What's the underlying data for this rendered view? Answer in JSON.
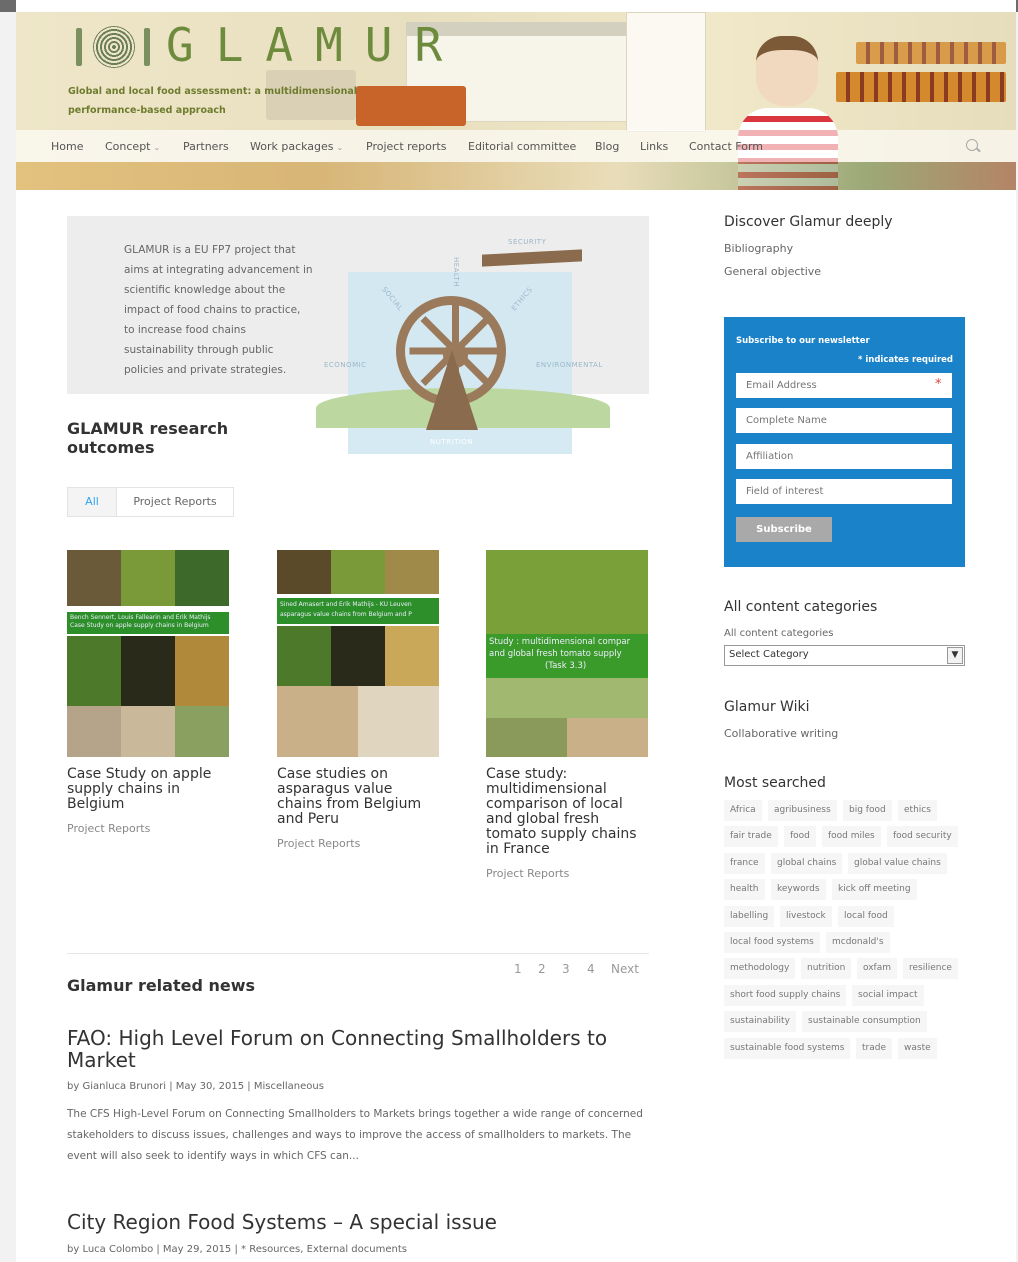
{
  "site": {
    "logo_text": "GLAMUR",
    "tagline_line1": "Global and local food assessment: a multidimensional",
    "tagline_line2": "performance-based approach"
  },
  "nav": {
    "items": [
      {
        "label": "Home",
        "dropdown": false
      },
      {
        "label": "Concept",
        "dropdown": true
      },
      {
        "label": "Partners",
        "dropdown": false
      },
      {
        "label": "Work packages",
        "dropdown": true
      },
      {
        "label": "Project reports",
        "dropdown": false
      },
      {
        "label": "Editorial committee",
        "dropdown": false
      },
      {
        "label": "Blog",
        "dropdown": false
      },
      {
        "label": "Links",
        "dropdown": false
      },
      {
        "label": "Contact Form",
        "dropdown": false
      }
    ],
    "dropdown_glyph": "⌄"
  },
  "intro": {
    "text": "GLAMUR is a EU FP7 project that aims at integrating advancement in scientific knowledge about the impact of food chains to practice, to increase food chains sustainability through public policies and private strategies.",
    "diagram_labels": {
      "security": "SECURITY",
      "economic": "ECONOMIC",
      "environmental": "ENVIRONMENTAL",
      "nutrition": "NUTRITION",
      "social": "SOCIAL",
      "health": "HEALTH",
      "ethics": "ETHICS"
    }
  },
  "outcomes": {
    "heading": "GLAMUR research outcomes",
    "filters": [
      "All",
      "Project Reports"
    ],
    "active_filter": "All",
    "cards": [
      {
        "title": "Case Study on apple supply chains in Belgium",
        "category": "Project Reports",
        "band_text_1": "Bench Sennert, Louis Fallearin and Erik Mathijs",
        "band_text_2": "Case Study on apple supply chains in Belgium"
      },
      {
        "title": "Case studies on asparagus value chains from Belgium and Peru",
        "category": "Project Reports",
        "band_text_1": "Sined Amasert and Erik Mathijs - KU Leuven",
        "band_text_2": "asparagus value chains from Belgium and P"
      },
      {
        "title": "Case study: multidimensional comparison of local and global fresh tomato supply chains in France",
        "category": "Project Reports",
        "band_text_1": "Study : multidimensional compar",
        "band_text_2": "and global fresh tomato supply",
        "band_text_3": "(Task 3.3)"
      }
    ]
  },
  "pagination": {
    "pages": [
      "1",
      "2",
      "3",
      "4"
    ],
    "next": "Next"
  },
  "news": {
    "heading": "Glamur related news",
    "posts": [
      {
        "title": "FAO: High Level Forum on Connecting Smallholders to Market",
        "meta": "by Gianluca Brunori | May 30, 2015 | Miscellaneous",
        "excerpt": "The CFS High-Level Forum on Connecting Smallholders to Markets brings together a wide range of concerned stakeholders to discuss issues, challenges and ways to improve the access of smallholders to markets. The event will also seek to identify ways in which CFS can..."
      },
      {
        "title": "City Region Food Systems – A special issue",
        "meta": "by Luca Colombo | May 29, 2015 | * Resources, External documents"
      }
    ]
  },
  "sidebar": {
    "discover": {
      "title": "Discover Glamur deeply",
      "links": [
        "Bibliography",
        "General objective"
      ]
    },
    "newsletter": {
      "title": "Subscribe to our newsletter",
      "required_note": "* indicates required",
      "fields": [
        {
          "placeholder": "Email Address",
          "required": true
        },
        {
          "placeholder": "Complete Name",
          "required": false
        },
        {
          "placeholder": "Affiliation",
          "required": false
        },
        {
          "placeholder": "Field of interest",
          "required": false
        }
      ],
      "button": "Subscribe",
      "color": "#1a82c9"
    },
    "categories": {
      "title": "All content categories",
      "label": "All content categories",
      "selected": "Select Category"
    },
    "wiki": {
      "title": "Glamur Wiki",
      "link": "Collaborative writing"
    },
    "most_searched": {
      "title": "Most searched",
      "tags": [
        "Africa",
        "agribusiness",
        "big food",
        "ethics",
        "fair trade",
        "food",
        "food miles",
        "food security",
        "france",
        "global chains",
        "global value chains",
        "health",
        "keywords",
        "kick off meeting",
        "labelling",
        "livestock",
        "local food",
        "local food systems",
        "mcdonald's",
        "methodology",
        "nutrition",
        "oxfam",
        "resilience",
        "short food supply chains",
        "social impact",
        "sustainability",
        "sustainable consumption",
        "sustainable food systems",
        "trade",
        "waste"
      ]
    }
  },
  "colors": {
    "accent": "#2ea3f2",
    "brand_green": "#6e8b3d"
  }
}
